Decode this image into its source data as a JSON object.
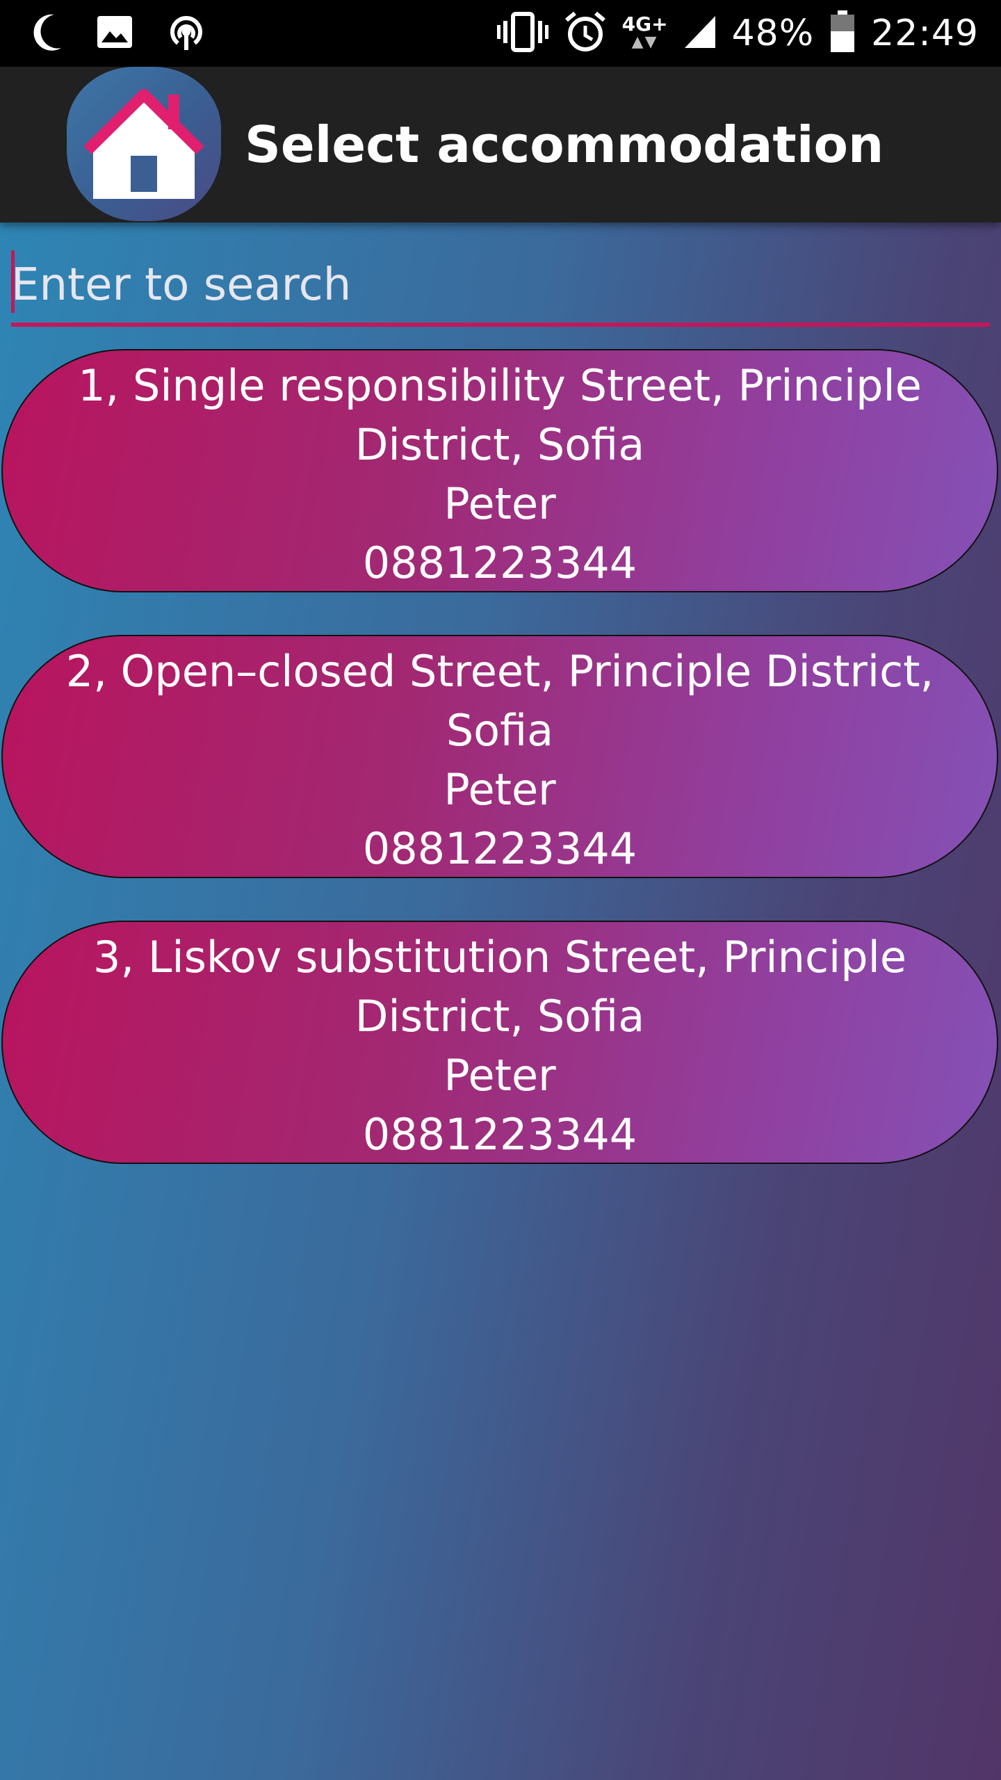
{
  "status_bar": {
    "battery_percent": "48%",
    "time": "22:49",
    "network_type": "4G+",
    "left_icons": [
      "moon-icon",
      "image-icon",
      "hotspot-icon"
    ],
    "right_icons": [
      "vibrate-icon",
      "alarm-icon",
      "network-4g-icon",
      "signal-icon",
      "battery-icon"
    ]
  },
  "toolbar": {
    "title": "Select accommodation",
    "app_icon": "house-icon"
  },
  "search": {
    "placeholder": "Enter to search",
    "value": ""
  },
  "accommodations": [
    {
      "address": "1, Single responsibility Street, Principle District, Sofia",
      "name": "Peter",
      "phone": "0881223344"
    },
    {
      "address": "2, Open–closed Street, Principle District, Sofia",
      "name": "Peter",
      "phone": "0881223344"
    },
    {
      "address": "3, Liskov substitution Street, Principle District, Sofia",
      "name": "Peter",
      "phone": "0881223344"
    }
  ],
  "colors": {
    "accent": "#c2185b",
    "toolbar": "#212121",
    "card_start": "#b8155e",
    "card_end": "#8451b6"
  }
}
